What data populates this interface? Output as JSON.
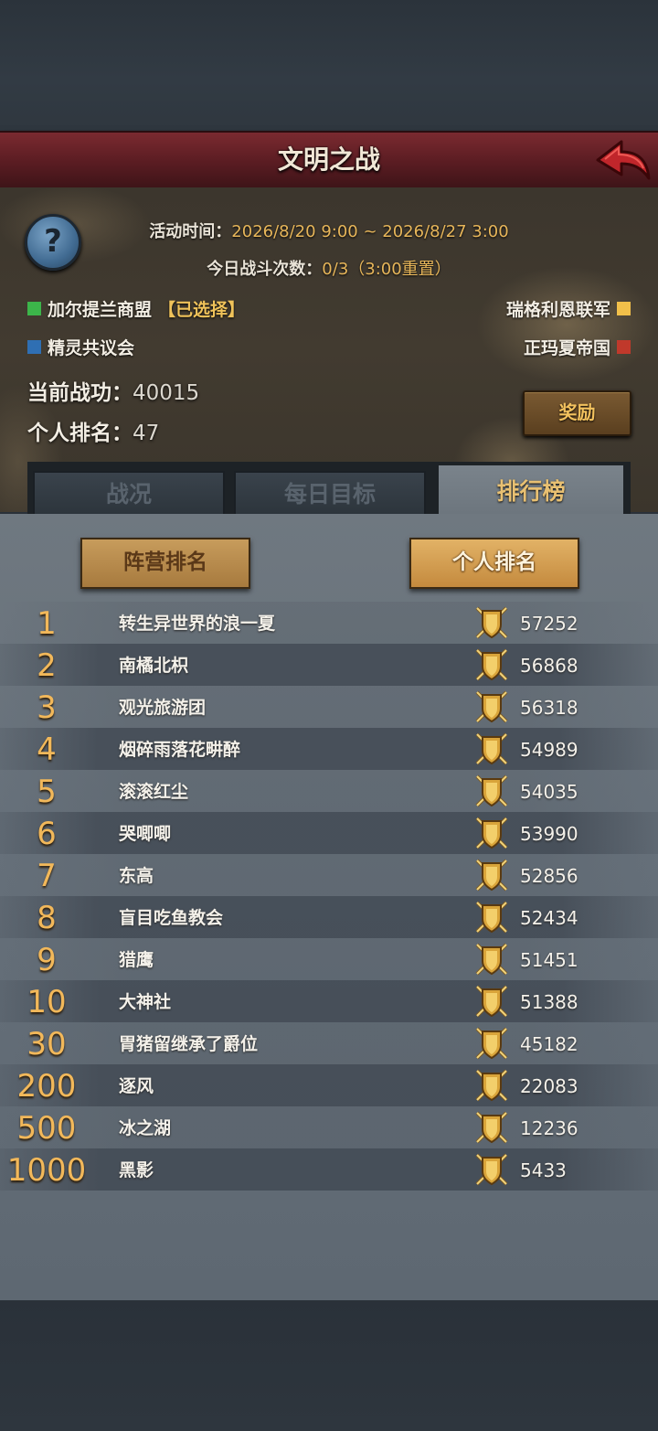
{
  "header": {
    "title": "文明之战"
  },
  "event_info": {
    "time_label": "活动时间：",
    "time_value": "2026/8/20 9:00 ~ 2026/8/27 3:00",
    "battles_label": "今日战斗次数：",
    "battles_value": "0/3（3:00重置）"
  },
  "factions": [
    {
      "name": "加尔提兰商盟",
      "suffix": "【已选择】",
      "color": "#3cb54a"
    },
    {
      "name": "精灵共议会",
      "suffix": "",
      "color": "#2f6fb3"
    },
    {
      "name": "瑞格利恩联军",
      "suffix": "",
      "color": "#f2c04a"
    },
    {
      "name": "正玛夏帝国",
      "suffix": "",
      "color": "#c0392b"
    }
  ],
  "stats": {
    "merit_label": "当前战功：",
    "merit_value": "40015",
    "rank_label": "个人排名：",
    "rank_value": "47"
  },
  "reward_button": "奖励",
  "tabs": [
    {
      "label": "战况",
      "active": false
    },
    {
      "label": "每日目标",
      "active": false
    },
    {
      "label": "排行榜",
      "active": true
    }
  ],
  "sub_tabs": {
    "faction_rank": "阵营排名",
    "personal_rank": "个人排名"
  },
  "ranking": [
    {
      "rank": "1",
      "name": "转生异世界的浪一夏",
      "score": "57252"
    },
    {
      "rank": "2",
      "name": "南橘北枳",
      "score": "56868"
    },
    {
      "rank": "3",
      "name": "观光旅游团",
      "score": "56318"
    },
    {
      "rank": "4",
      "name": "烟碎雨落花畊醉",
      "score": "54989"
    },
    {
      "rank": "5",
      "name": "滚滚红尘",
      "score": "54035"
    },
    {
      "rank": "6",
      "name": "哭唧唧",
      "score": "53990"
    },
    {
      "rank": "7",
      "name": "东高",
      "score": "52856"
    },
    {
      "rank": "8",
      "name": "盲目吃鱼教会",
      "score": "52434"
    },
    {
      "rank": "9",
      "name": "猎鹰",
      "score": "51451"
    },
    {
      "rank": "10",
      "name": "大神社",
      "score": "51388"
    },
    {
      "rank": "30",
      "name": "胃猪留继承了爵位",
      "score": "45182"
    },
    {
      "rank": "200",
      "name": "逐风",
      "score": "22083"
    },
    {
      "rank": "500",
      "name": "冰之湖",
      "score": "12236"
    },
    {
      "rank": "1000",
      "name": "黑影",
      "score": "5433"
    }
  ],
  "colors": {
    "accent_gold": "#e7b65a",
    "title_bar": "#5a1c22",
    "back_arrow": "#c0262b"
  },
  "icons": {
    "help": "question-icon",
    "back": "back-arrow-icon",
    "badge": "shield-swords-icon"
  }
}
